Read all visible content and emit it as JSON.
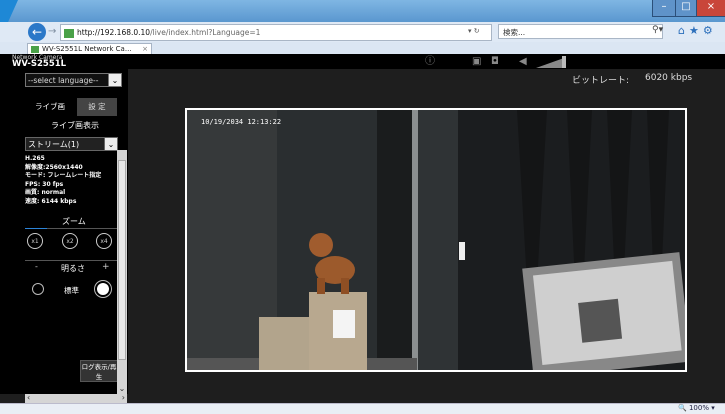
{
  "browser": {
    "url_host": "http://192.168.0.10",
    "url_path": "/live/index.html?Language=1",
    "search_placeholder": "検索...",
    "tab_title": "WV-S2551L Network Ca...",
    "tab_close": "×",
    "zoom": "100%"
  },
  "header": {
    "brand_sub": "Network Camera",
    "brand": "WV-S2551L"
  },
  "sidebar": {
    "language_select": "--select language--",
    "tab_live": "ライブ画",
    "tab_settings": "設 定",
    "section_live": "ライブ画表示",
    "stream_select": "ストリーム(1)",
    "info": [
      "H.265",
      "解像度:2560x1440",
      "モード: フレームレート指定",
      "FPS: 30 fps",
      "画質: normal",
      "速度: 6144 kbps"
    ],
    "zoom_title": "ズーム",
    "zoom_buttons": [
      "x1",
      "x2",
      "x4"
    ],
    "brightness_title": "明るさ",
    "brightness_minus": "-",
    "brightness_plus": "+",
    "brightness_standard": "標準",
    "log_button": "ログ表示/再生"
  },
  "main": {
    "bitrate_label": "ビットレート:",
    "bitrate_value": "6020 kbps",
    "timestamp": "10/19/2034 12:13:22"
  },
  "colors": {
    "accent": "#2c84d8",
    "header_bg": "#000000",
    "main_bg": "#1e1e1e"
  }
}
